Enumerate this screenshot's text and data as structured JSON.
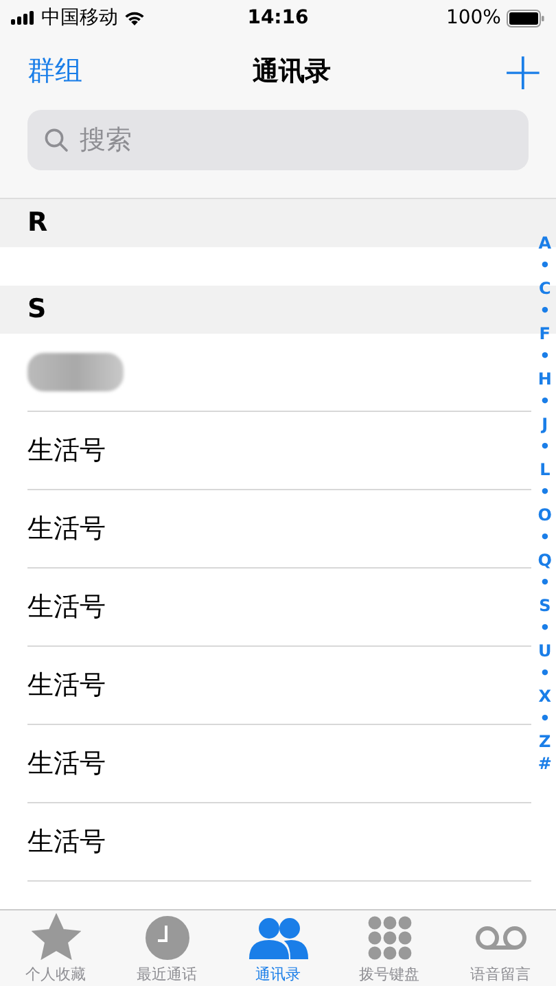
{
  "status_bar": {
    "carrier": "中国移动",
    "time": "14:16",
    "battery": "100%"
  },
  "nav": {
    "left": "群组",
    "title": "通讯录",
    "right": "+"
  },
  "search": {
    "placeholder": "搜索"
  },
  "sections": [
    {
      "letter": "R",
      "rows": [
        {
          "kind": "cut"
        }
      ]
    },
    {
      "letter": "S",
      "rows": [
        {
          "kind": "redacted"
        },
        {
          "kind": "name",
          "name": "生活号"
        },
        {
          "kind": "name",
          "name": "生活号"
        },
        {
          "kind": "name",
          "name": "生活号"
        },
        {
          "kind": "name",
          "name": "生活号"
        },
        {
          "kind": "name",
          "name": "生活号"
        },
        {
          "kind": "name",
          "name": "生活号"
        },
        {
          "kind": "cut"
        }
      ]
    }
  ],
  "index": [
    "A",
    "•",
    "C",
    "•",
    "F",
    "•",
    "H",
    "•",
    "J",
    "•",
    "L",
    "•",
    "O",
    "•",
    "Q",
    "•",
    "S",
    "•",
    "U",
    "•",
    "X",
    "•",
    "Z",
    "#"
  ],
  "tabs": [
    {
      "label": "个人收藏",
      "kind": "star",
      "selected": false
    },
    {
      "label": "最近通话",
      "kind": "clock",
      "selected": false
    },
    {
      "label": "通讯录",
      "kind": "people",
      "selected": true
    },
    {
      "label": "拨号键盘",
      "kind": "keypad",
      "selected": false
    },
    {
      "label": "语音留言",
      "kind": "voicemail",
      "selected": false
    }
  ]
}
